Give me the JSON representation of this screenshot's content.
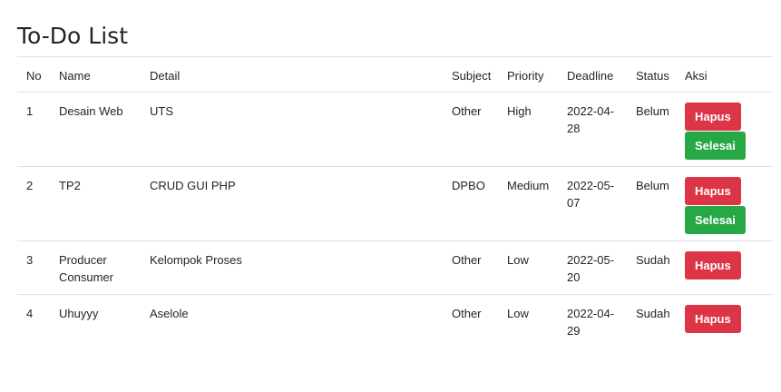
{
  "page": {
    "title": "To-Do List"
  },
  "table": {
    "headers": {
      "no": "No",
      "name": "Name",
      "detail": "Detail",
      "subject": "Subject",
      "priority": "Priority",
      "deadline": "Deadline",
      "status": "Status",
      "aksi": "Aksi"
    },
    "rows": [
      {
        "no": "1",
        "name": "Desain Web",
        "detail": "UTS",
        "subject": "Other",
        "priority": "High",
        "deadline_line1": "2022-04-",
        "deadline_line2": "28",
        "status": "Belum",
        "hapus": "Hapus",
        "selesai": "Selesai"
      },
      {
        "no": "2",
        "name": "TP2",
        "detail": "CRUD GUI PHP",
        "subject": "DPBO",
        "priority": "Medium",
        "deadline_line1": "2022-05-",
        "deadline_line2": "07",
        "status": "Belum",
        "hapus": "Hapus",
        "selesai": "Selesai"
      },
      {
        "no": "3",
        "name_line1": "Producer",
        "name_line2": "Consumer",
        "detail": "Kelompok Proses",
        "subject": "Other",
        "priority": "Low",
        "deadline_line1": "2022-05-",
        "deadline_line2": "20",
        "status": "Sudah",
        "hapus": "Hapus"
      },
      {
        "no": "4",
        "name": "Uhuyyy",
        "detail": "Aselole",
        "subject": "Other",
        "priority": "Low",
        "deadline_line1": "2022-04-",
        "deadline_line2": "29",
        "status": "Sudah",
        "hapus": "Hapus"
      }
    ]
  },
  "colors": {
    "hapus": "#dc3545",
    "selesai": "#28a745",
    "border": "#dee2e6",
    "text": "#212529"
  }
}
